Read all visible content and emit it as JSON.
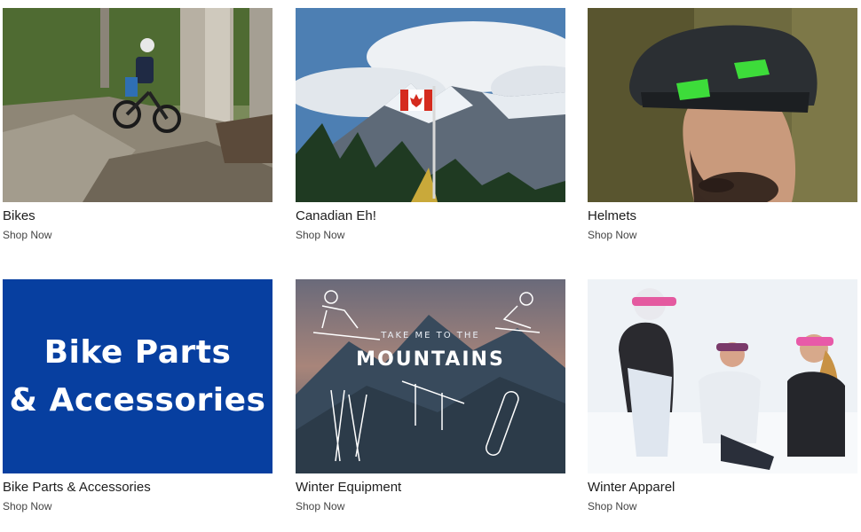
{
  "categories": [
    {
      "title": "Bikes",
      "cta": "Shop Now"
    },
    {
      "title": "Canadian Eh!",
      "cta": "Shop Now"
    },
    {
      "title": "Helmets",
      "cta": "Shop Now"
    },
    {
      "title": "Bike Parts & Accessories",
      "cta": "Shop Now",
      "banner_line1": "Bike Parts",
      "banner_line2": "& Accessories"
    },
    {
      "title": "Winter Equipment",
      "cta": "Shop Now",
      "image_small_text": "TAKE ME TO THE",
      "image_big_text": "MOUNTAINS"
    },
    {
      "title": "Winter Apparel",
      "cta": "Shop Now"
    }
  ],
  "colors": {
    "banner_blue": "#073fa0",
    "helmet_green": "#3ddc3a"
  },
  "icons": [
    "mountain-bike-photo",
    "canadian-flag-photo",
    "helmet-photo",
    "ski-sketch",
    "snowboard-sketch",
    "skiers-photo"
  ]
}
